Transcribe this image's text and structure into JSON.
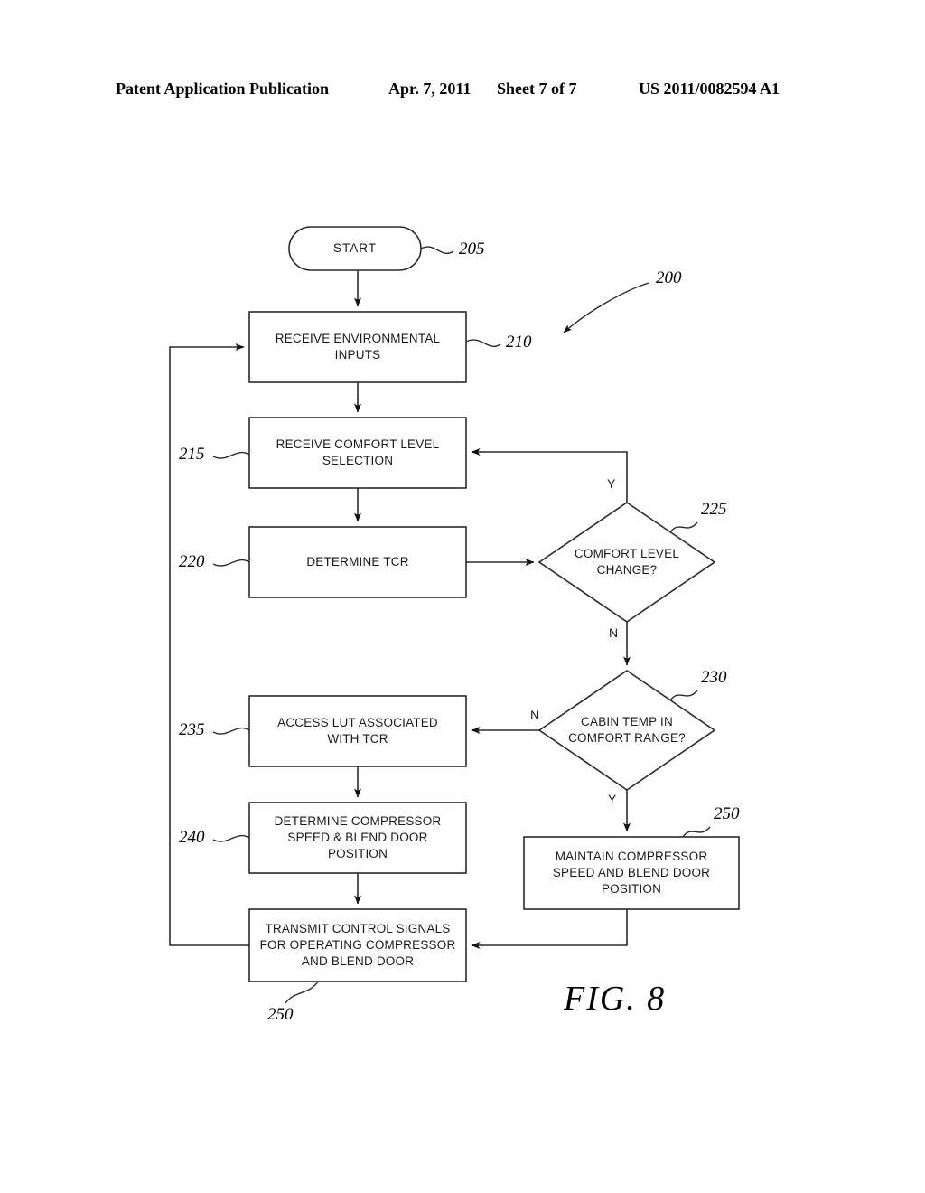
{
  "header": {
    "publication": "Patent Application Publication",
    "date": "Apr. 7, 2011",
    "sheet": "Sheet 7 of 7",
    "patent_number": "US 2011/0082594 A1"
  },
  "figure": {
    "caption": "FIG. 8",
    "diagram_ref": "200"
  },
  "nodes": [
    {
      "id": "start",
      "ref": "205",
      "text": "START",
      "shape": "terminator"
    },
    {
      "id": "n210",
      "ref": "210",
      "text": "RECEIVE ENVIRONMENTAL\nINPUTS",
      "shape": "process"
    },
    {
      "id": "n215",
      "ref": "215",
      "text": "RECEIVE COMFORT LEVEL\nSELECTION",
      "shape": "process"
    },
    {
      "id": "n220",
      "ref": "220",
      "text": "DETERMINE TCR",
      "shape": "process"
    },
    {
      "id": "n225",
      "ref": "225",
      "text": "COMFORT LEVEL\nCHANGE?",
      "shape": "decision"
    },
    {
      "id": "n230",
      "ref": "230",
      "text": "CABIN TEMP IN\nCOMFORT RANGE?",
      "shape": "decision"
    },
    {
      "id": "n235",
      "ref": "235",
      "text": "ACCESS LUT ASSOCIATED\nWITH TCR",
      "shape": "process"
    },
    {
      "id": "n240",
      "ref": "240",
      "text": "DETERMINE COMPRESSOR\nSPEED & BLEND DOOR\nPOSITION",
      "shape": "process"
    },
    {
      "id": "n250main",
      "ref": "250",
      "text": "MAINTAIN COMPRESSOR\nSPEED AND BLEND DOOR\nPOSITION",
      "shape": "process"
    },
    {
      "id": "n250tx",
      "ref": "250",
      "text": "TRANSMIT CONTROL SIGNALS\nFOR OPERATING COMPRESSOR\nAND BLEND DOOR",
      "shape": "process"
    }
  ],
  "branch_labels": {
    "comfort_change_yes": "Y",
    "comfort_change_no": "N",
    "cabin_temp_no": "N",
    "cabin_temp_yes": "Y"
  },
  "colors": {
    "ink": "#000000",
    "text": "#1a1a1a",
    "background": "#ffffff"
  }
}
